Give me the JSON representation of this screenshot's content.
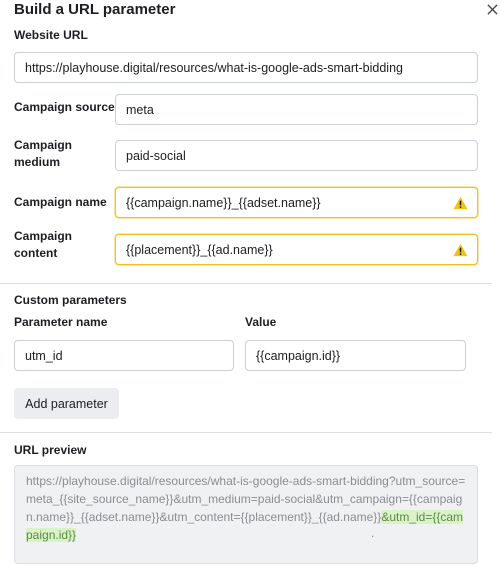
{
  "dialog": {
    "title": "Build a URL parameter",
    "close_icon": "close-icon"
  },
  "website_url": {
    "label": "Website URL",
    "value": "https://playhouse.digital/resources/what-is-google-ads-smart-bidding"
  },
  "campaign_source": {
    "label": "Campaign source",
    "value": "meta"
  },
  "campaign_medium": {
    "label_line1": "Campaign",
    "label_line2": "medium",
    "value": "paid-social"
  },
  "campaign_name": {
    "label": "Campaign name",
    "value": "{{campaign.name}}_{{adset.name}}",
    "warning_icon": "warning-icon"
  },
  "campaign_content": {
    "label_line1": "Campaign",
    "label_line2": "content",
    "value": "{{placement}}_{{ad.name}}",
    "warning_icon": "warning-icon"
  },
  "custom_parameters": {
    "heading": "Custom parameters",
    "name_header": "Parameter name",
    "value_header": "Value",
    "rows": [
      {
        "name": "utm_id",
        "value": "{{campaign.id}}"
      }
    ],
    "add_button": "Add parameter"
  },
  "url_preview": {
    "heading": "URL preview",
    "text_main": "https://playhouse.digital/resources/what-is-google-ads-smart-bidding?utm_source=meta_{{site_source_name}}&utm_medium=paid-social&utm_campaign={{campaign.name}}_{{adset.name}}&utm_content={{placement}}_{{ad.name}}",
    "text_highlight": "&utm_id={{campaign.id}}",
    "trailing": "."
  },
  "colors": {
    "warning": "#f1c21b",
    "highlight_bg": "#d9f2c8",
    "border": "#cbd0d6"
  }
}
